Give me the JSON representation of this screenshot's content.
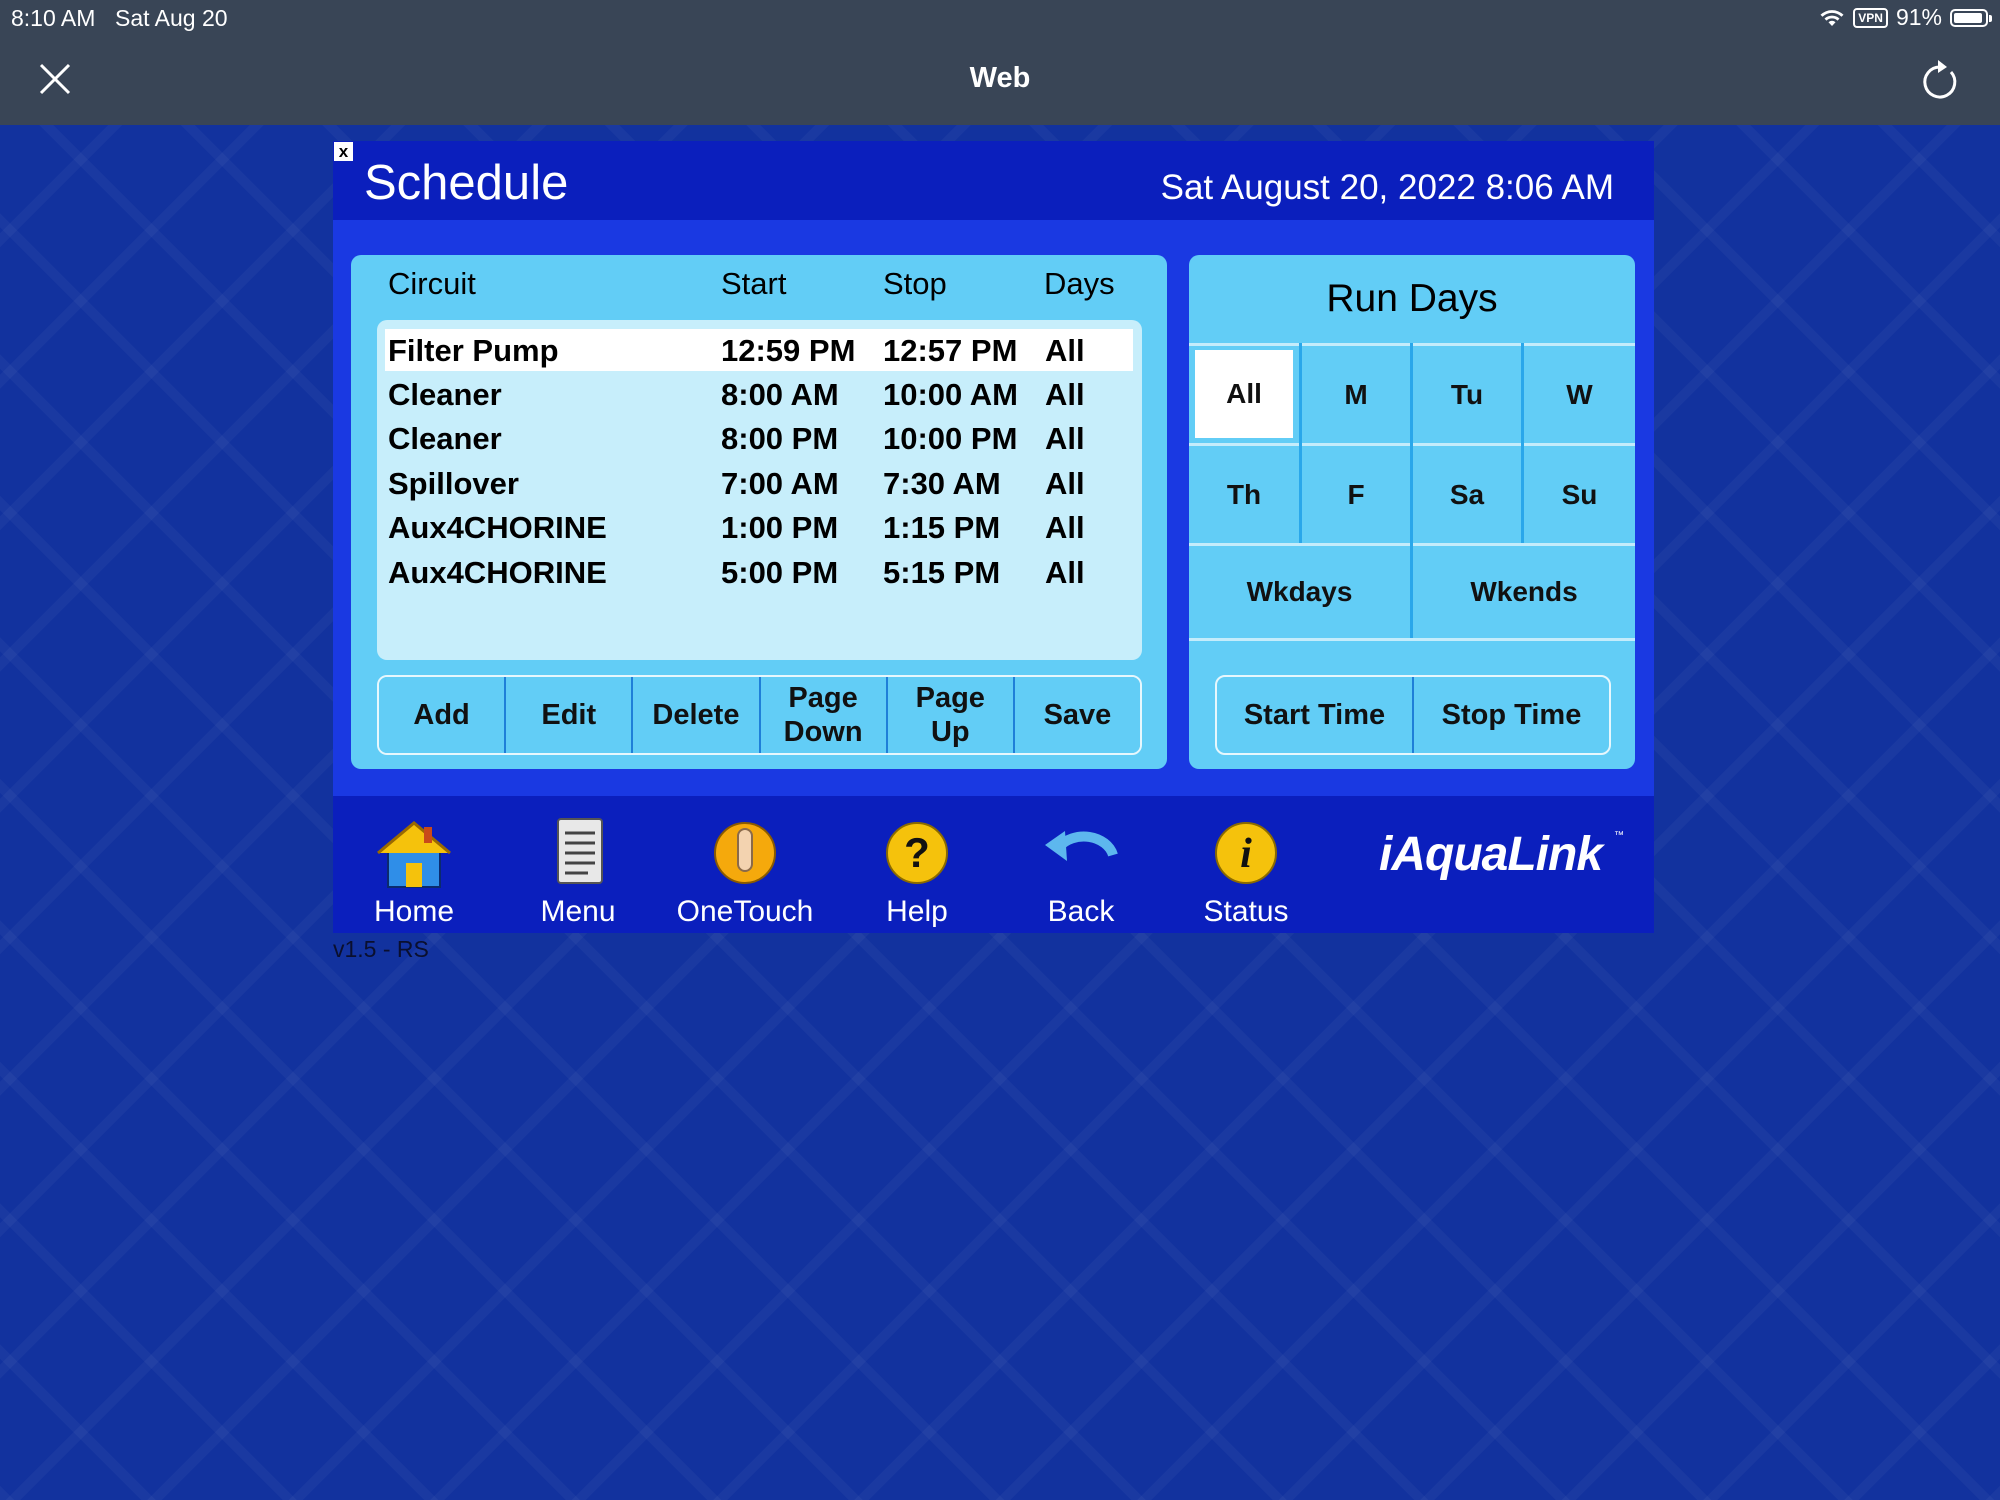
{
  "status_bar": {
    "time": "8:10 AM",
    "date": "Sat Aug 20",
    "vpn": "VPN",
    "battery": "91%"
  },
  "browser": {
    "title": "Web",
    "close_icon": "close-icon",
    "reload_icon": "reload-icon"
  },
  "app": {
    "close_label": "x",
    "title": "Schedule",
    "datetime": "Sat August 20, 2022 8:06 AM",
    "version": "v1.5 - RS"
  },
  "schedule": {
    "headers": {
      "circuit": "Circuit",
      "start": "Start",
      "stop": "Stop",
      "days": "Days"
    },
    "rows": [
      {
        "circuit": "Filter Pump",
        "start": "12:59 PM",
        "stop": "12:57 PM",
        "days": "All",
        "selected": true
      },
      {
        "circuit": "Cleaner",
        "start": "8:00 AM",
        "stop": "10:00 AM",
        "days": "All"
      },
      {
        "circuit": "Cleaner",
        "start": "8:00 PM",
        "stop": "10:00 PM",
        "days": "All"
      },
      {
        "circuit": "Spillover",
        "start": "7:00 AM",
        "stop": "7:30 AM",
        "days": "All"
      },
      {
        "circuit": "Aux4CHORINE",
        "start": "1:00 PM",
        "stop": "1:15 PM",
        "days": "All"
      },
      {
        "circuit": "Aux4CHORINE",
        "start": "5:00 PM",
        "stop": "5:15 PM",
        "days": "All"
      }
    ],
    "buttons": {
      "add": "Add",
      "edit": "Edit",
      "delete": "Delete",
      "page_down_1": "Page",
      "page_down_2": "Down",
      "page_up_1": "Page",
      "page_up_2": "Up",
      "save": "Save"
    }
  },
  "run_days": {
    "title": "Run Days",
    "days": {
      "all": "All",
      "m": "M",
      "tu": "Tu",
      "w": "W",
      "th": "Th",
      "f": "F",
      "sa": "Sa",
      "su": "Su",
      "wkdays": "Wkdays",
      "wkends": "Wkends"
    },
    "selected": "All",
    "start_time": "Start Time",
    "stop_time": "Stop Time"
  },
  "nav": {
    "home": "Home",
    "menu": "Menu",
    "onetouch": "OneTouch",
    "help": "Help",
    "back": "Back",
    "status": "Status"
  },
  "logo": {
    "text": "iAquaLink",
    "tm": "™"
  },
  "colors": {
    "background": "#12329e",
    "app_bg": "#0b1fbd",
    "panel": "#62cdf6",
    "list_bg": "#c7eefb",
    "header_bar": "#394556"
  }
}
